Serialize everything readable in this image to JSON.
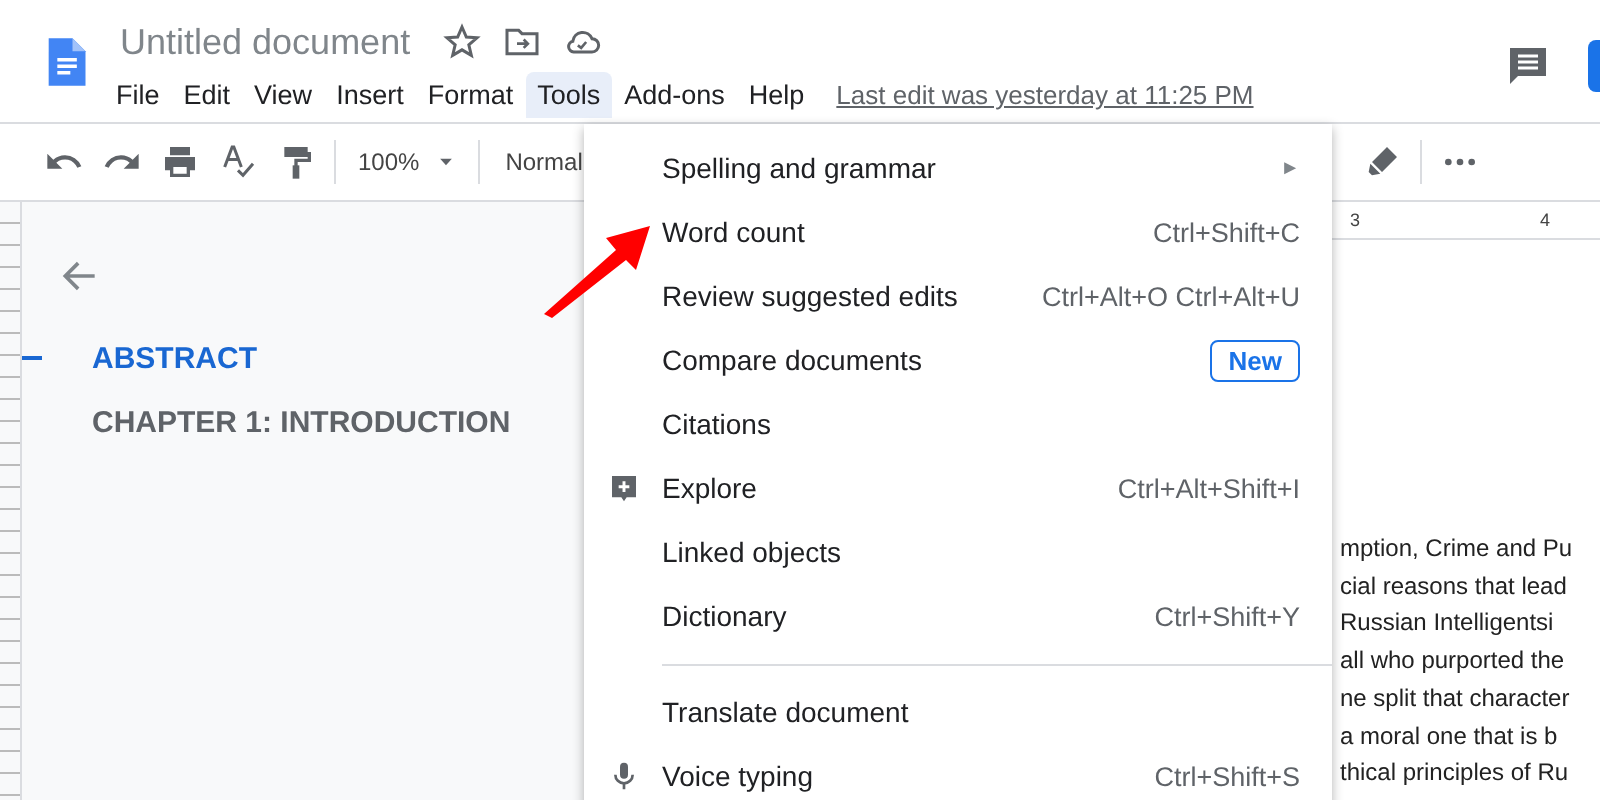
{
  "doc_title": "Untitled document",
  "menu_bar": [
    {
      "label": "File",
      "selected": false
    },
    {
      "label": "Edit",
      "selected": false
    },
    {
      "label": "View",
      "selected": false
    },
    {
      "label": "Insert",
      "selected": false
    },
    {
      "label": "Format",
      "selected": false
    },
    {
      "label": "Tools",
      "selected": true
    },
    {
      "label": "Add-ons",
      "selected": false
    },
    {
      "label": "Help",
      "selected": false
    }
  ],
  "last_edit": "Last edit was yesterday at 11:25 PM",
  "toolbar": {
    "zoom": "100%",
    "style": "Normal"
  },
  "ruler_labels": [
    "3",
    "4"
  ],
  "outline": [
    {
      "label": "ABSTRACT",
      "selected": true
    },
    {
      "label": "CHAPTER 1: INTRODUCTION",
      "selected": false
    }
  ],
  "tools_menu": [
    {
      "kind": "submenu",
      "label": "Spelling and grammar",
      "arrow": "►"
    },
    {
      "kind": "shortcut",
      "label": "Word count",
      "shortcut": "Ctrl+Shift+C"
    },
    {
      "kind": "shortcut",
      "label": "Review suggested edits",
      "shortcut": "Ctrl+Alt+O Ctrl+Alt+U"
    },
    {
      "kind": "badge",
      "label": "Compare documents",
      "badge": "New"
    },
    {
      "kind": "plain",
      "label": "Citations"
    },
    {
      "kind": "explore",
      "label": "Explore",
      "shortcut": "Ctrl+Alt+Shift+I"
    },
    {
      "kind": "plain",
      "label": "Linked objects"
    },
    {
      "kind": "shortcut",
      "label": "Dictionary",
      "shortcut": "Ctrl+Shift+Y"
    },
    {
      "kind": "separator"
    },
    {
      "kind": "plain",
      "label": "Translate document"
    },
    {
      "kind": "voice",
      "label": "Voice typing",
      "shortcut": "Ctrl+Shift+S"
    }
  ],
  "document_lines": [
    "mption, Crime and Pu",
    "cial reasons that lead",
    "Russian Intelligentsi",
    "all who purported the",
    "ne split that character",
    "a moral one that is b",
    "thical principles of Ru"
  ]
}
